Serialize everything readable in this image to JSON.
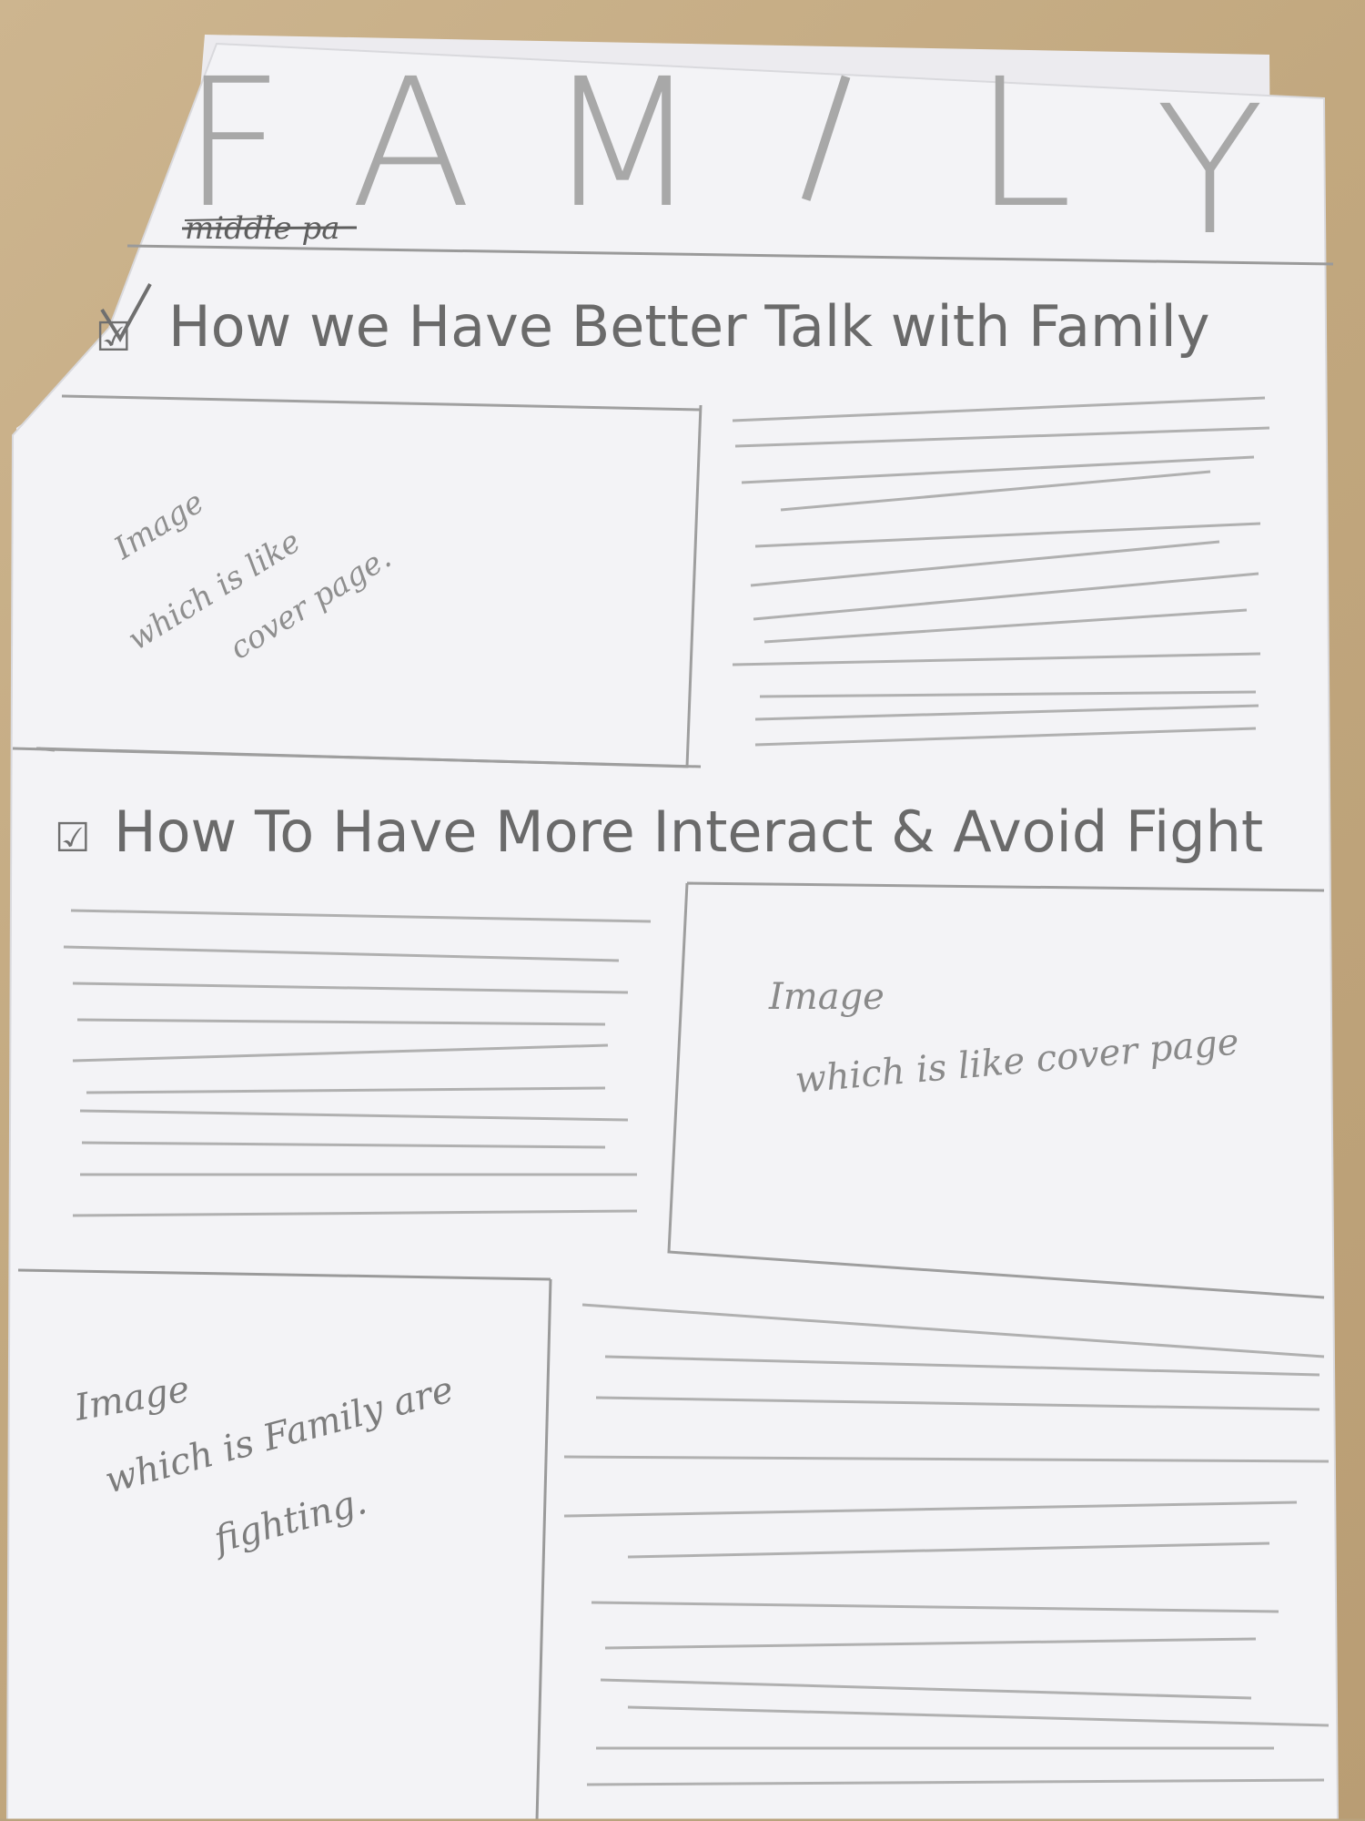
{
  "sketch": {
    "title": "FAMILY",
    "title_letters": [
      "F",
      "A",
      "M",
      "I",
      "L",
      "Y"
    ],
    "crossed_note": "middle pa",
    "section1": {
      "checkbox": "☑",
      "heading": "How we Have Better Talk with Family",
      "image_label": [
        "Image",
        "which is like",
        "cover page."
      ]
    },
    "section2": {
      "checkbox": "☑",
      "heading": "How To Have More Interact & Avoid Fight",
      "image_label": [
        "Image",
        "which is like cover page"
      ]
    },
    "section3": {
      "image_label": [
        "Image",
        "which is Family are",
        "fighting."
      ]
    }
  }
}
